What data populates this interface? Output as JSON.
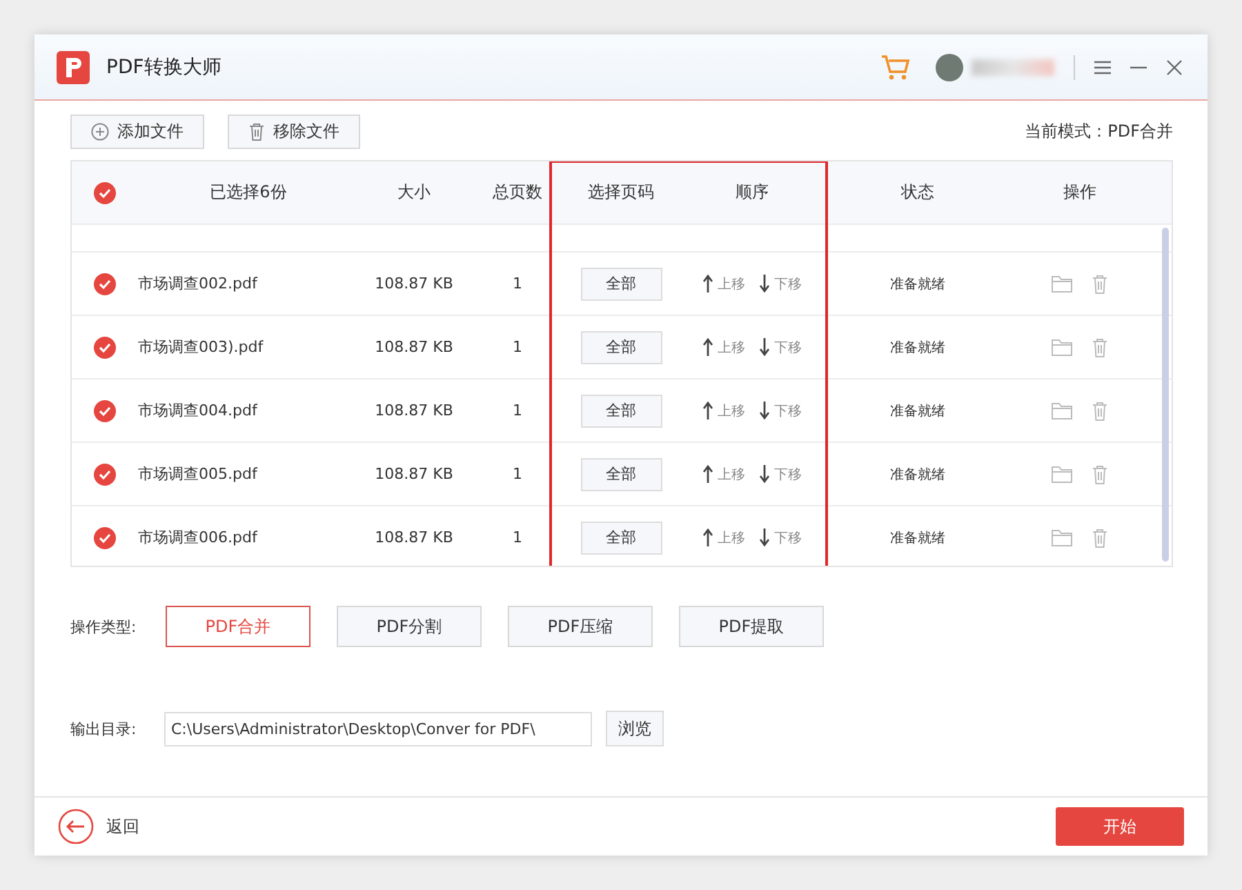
{
  "window": {
    "title": "PDF转换大师"
  },
  "toolbar": {
    "add_button": "添加文件",
    "remove_button": "移除文件",
    "mode_label": "当前模式：PDF合并"
  },
  "table": {
    "all_checked": true,
    "columns": [
      "已选择6份",
      "大小",
      "总页数",
      "选择页码",
      "顺序",
      "状态",
      "操作"
    ],
    "rows": [
      {
        "checked": true,
        "name": "市场调查002.pdf",
        "size": "108.87 KB",
        "pages": "1",
        "page_button": "全部",
        "up": "上移",
        "down": "下移",
        "status": "准备就绪"
      },
      {
        "checked": true,
        "name": "市场调查003).pdf",
        "size": "108.87 KB",
        "pages": "1",
        "page_button": "全部",
        "up": "上移",
        "down": "下移",
        "status": "准备就绪"
      },
      {
        "checked": true,
        "name": "市场调查004.pdf",
        "size": "108.87 KB",
        "pages": "1",
        "page_button": "全部",
        "up": "上移",
        "down": "下移",
        "status": "准备就绪"
      },
      {
        "checked": true,
        "name": "市场调查005.pdf",
        "size": "108.87 KB",
        "pages": "1",
        "page_button": "全部",
        "up": "上移",
        "down": "下移",
        "status": "准备就绪"
      },
      {
        "checked": true,
        "name": "市场调查006.pdf",
        "size": "108.87 KB",
        "pages": "1",
        "page_button": "全部",
        "up": "上移",
        "down": "下移",
        "status": "准备就绪"
      }
    ]
  },
  "operation": {
    "label": "操作类型:",
    "types": [
      {
        "label": "PDF合并",
        "selected": true
      },
      {
        "label": "PDF分割",
        "selected": false
      },
      {
        "label": "PDF压缩",
        "selected": false
      },
      {
        "label": "PDF提取",
        "selected": false
      }
    ]
  },
  "output": {
    "label": "输出目录:",
    "path": "C:\\Users\\Administrator\\Desktop\\Conver for PDF\\",
    "browse_button": "浏览"
  },
  "footer": {
    "back": "返回",
    "start_button": "开始"
  }
}
